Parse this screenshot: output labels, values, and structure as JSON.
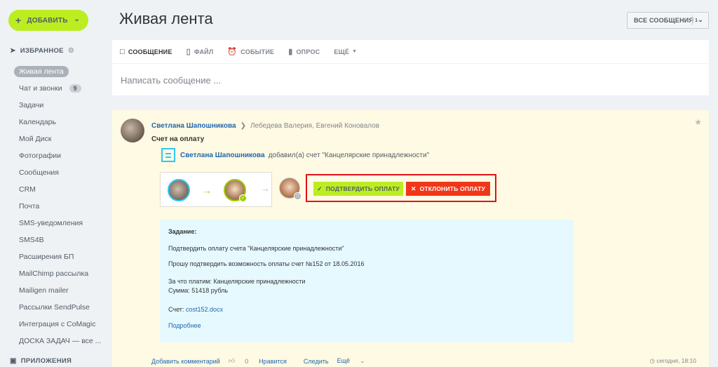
{
  "sidebar": {
    "add_label": "ДОБАВИТЬ",
    "favorites_label": "ИЗБРАННОЕ",
    "apps_label": "ПРИЛОЖЕНИЯ",
    "items": [
      {
        "label": "Живая лента",
        "active": true
      },
      {
        "label": "Чат и звонки",
        "counter": "9"
      },
      {
        "label": "Задачи"
      },
      {
        "label": "Календарь"
      },
      {
        "label": "Мой Диск"
      },
      {
        "label": "Фотографии"
      },
      {
        "label": "Сообщения"
      },
      {
        "label": "CRM"
      },
      {
        "label": "Почта"
      },
      {
        "label": "SMS-уведомления"
      },
      {
        "label": "SMS4B"
      },
      {
        "label": "Расширения БП"
      },
      {
        "label": "MailChimp рассылка"
      },
      {
        "label": "Mailigen mailer"
      },
      {
        "label": "Рассылки SendPulse"
      },
      {
        "label": "Интеграция с CoMagic"
      },
      {
        "label": "ДОСКА ЗАДАЧ — все ..."
      }
    ]
  },
  "header": {
    "title": "Живая лента",
    "filter_label": "ВСЕ СООБЩЕНИЯ",
    "filter_count": "1"
  },
  "composer": {
    "tabs": [
      "СООБЩЕНИЕ",
      "ФАЙЛ",
      "СОБЫТИЕ",
      "ОПРОС",
      "ЕЩЁ"
    ],
    "placeholder": "Написать сообщение ..."
  },
  "post": {
    "author": "Светлана Шапошникова",
    "recipients": "Лебедева Валерия, Евгений Коновалов",
    "title": "Счет на оплату",
    "sub_author": "Светлана Шапошникова",
    "sub_text": "добавил(а) счет \"Канцелярские принадлежности\"",
    "approve_label": "ПОДТВЕРДИТЬ ОПЛАТУ",
    "reject_label": "ОТКЛОНИТЬ ОПЛАТУ",
    "task": {
      "heading": "Задание:",
      "line1": "Подтвердить оплату счета \"Канцелярские принадлежности\"",
      "line2": "Прошу подтвердить возможность оплаты счет №152 от 18.05.2016",
      "line3": "За что платим: Канцелярские принадлежности",
      "line4": "Сумма: 51418 рубль",
      "invoice_label": "Счет:",
      "invoice_file": "cost152.docx",
      "more": "Подробнее"
    },
    "footer": {
      "comment": "Добавить комментарий",
      "likes": "0",
      "like_label": "Нравится",
      "follow": "Следить",
      "more": "Ещё"
    },
    "date": "сегодня, 18:10"
  }
}
